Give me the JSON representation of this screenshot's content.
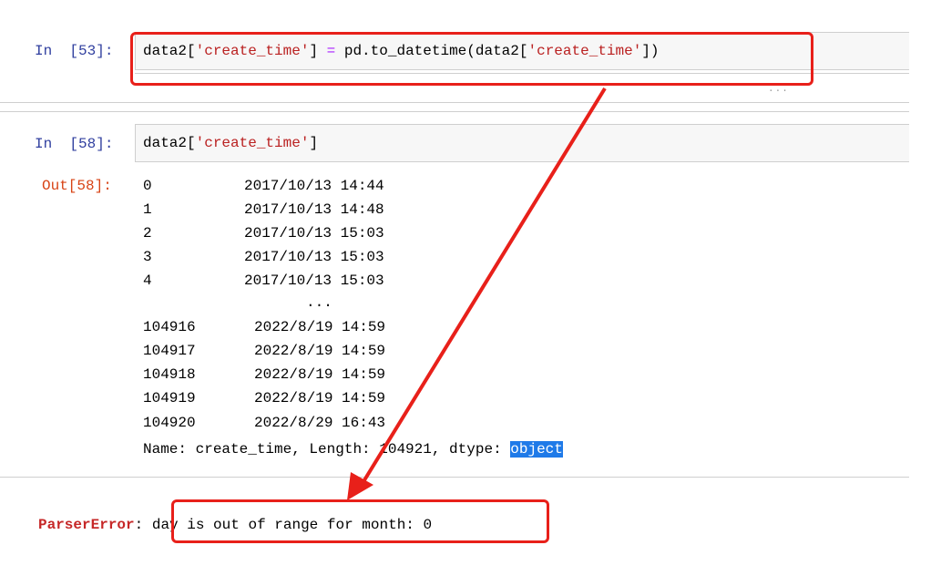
{
  "cells": [
    {
      "prompt": "In  [53]:",
      "code": {
        "p1": "data2[",
        "s1": "'create_time'",
        "p2": "] ",
        "op": "=",
        "p3": " pd.to_datetime(data2[",
        "s2": "'create_time'",
        "p4": "])"
      },
      "collapsed_marker": "..."
    },
    {
      "prompt": "In  [58]:",
      "code": {
        "p1": "data2[",
        "s1": "'create_time'",
        "p2": "]"
      }
    }
  ],
  "output": {
    "prompt": "Out[58]:",
    "rows": [
      {
        "index": "0",
        "value": "2017/10/13 14:44"
      },
      {
        "index": "1",
        "value": "2017/10/13 14:48"
      },
      {
        "index": "2",
        "value": "2017/10/13 15:03"
      },
      {
        "index": "3",
        "value": "2017/10/13 15:03"
      },
      {
        "index": "4",
        "value": "2017/10/13 15:03"
      },
      {
        "index": "",
        "value": "..."
      },
      {
        "index": "104916",
        "value": "2022/8/19 14:59"
      },
      {
        "index": "104917",
        "value": "2022/8/19 14:59"
      },
      {
        "index": "104918",
        "value": "2022/8/19 14:59"
      },
      {
        "index": "104919",
        "value": "2022/8/19 14:59"
      },
      {
        "index": "104920",
        "value": "2022/8/29 16:43"
      }
    ],
    "footer_prefix": "Name: create_time, Length: 104921, dtype: ",
    "footer_dtype": "object"
  },
  "error": {
    "name": "ParserError",
    "sep": ":",
    "message": "day is out of range for month: 0"
  },
  "colors": {
    "annotation": "#e8201a",
    "selection": "#1f7ae8",
    "in_prompt": "#303f9f",
    "out_prompt": "#d84315"
  }
}
